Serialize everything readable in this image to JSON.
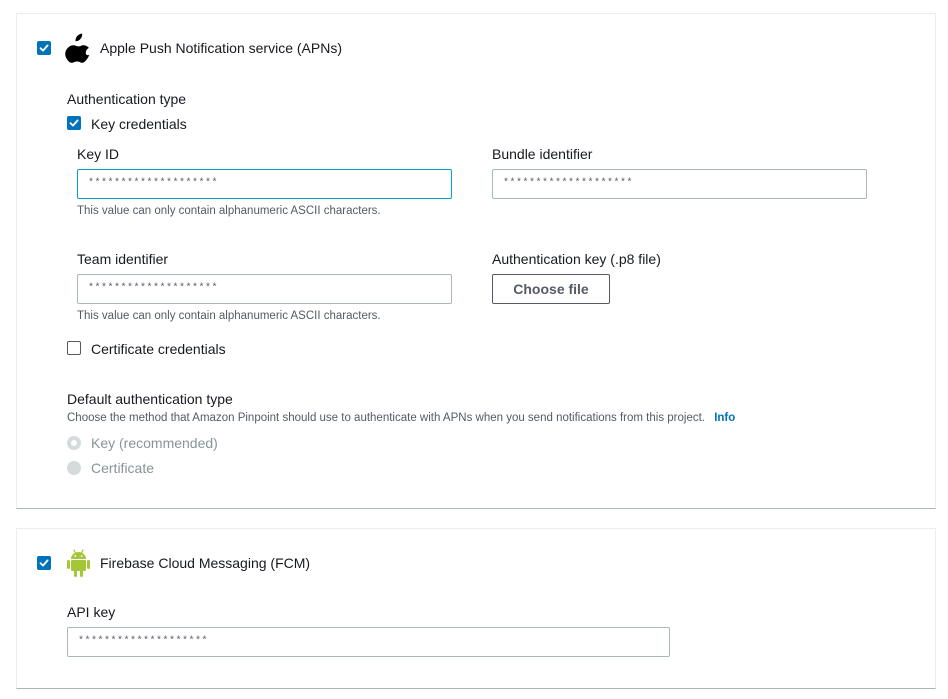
{
  "apns": {
    "enabled": true,
    "title": "Apple Push Notification service (APNs)",
    "icon": "apple-logo-icon",
    "auth_type_label": "Authentication type",
    "key_credentials": {
      "checked": true,
      "label": "Key credentials",
      "key_id_label": "Key ID",
      "key_id_value": "********************",
      "key_id_hint": "This value can only contain alphanumeric ASCII characters.",
      "bundle_label": "Bundle identifier",
      "bundle_value": "********************",
      "team_label": "Team identifier",
      "team_value": "********************",
      "team_hint": "This value can only contain alphanumeric ASCII characters.",
      "auth_key_label": "Authentication key (.p8 file)",
      "choose_file_label": "Choose file"
    },
    "certificate_credentials": {
      "checked": false,
      "label": "Certificate credentials"
    },
    "default_auth": {
      "label": "Default authentication type",
      "description": "Choose the method that Amazon Pinpoint should use to authenticate with APNs when you send notifications from this project.",
      "info_link": "Info",
      "options": [
        {
          "label": "Key (recommended)",
          "selected": true
        },
        {
          "label": "Certificate",
          "selected": false
        }
      ]
    }
  },
  "fcm": {
    "enabled": true,
    "title": "Firebase Cloud Messaging (FCM)",
    "icon": "android-logo-icon",
    "api_key_label": "API key",
    "api_key_value": "********************"
  },
  "colors": {
    "accent": "#0073bb",
    "focus_border": "#00a1c9",
    "android_green": "#a4c639"
  }
}
